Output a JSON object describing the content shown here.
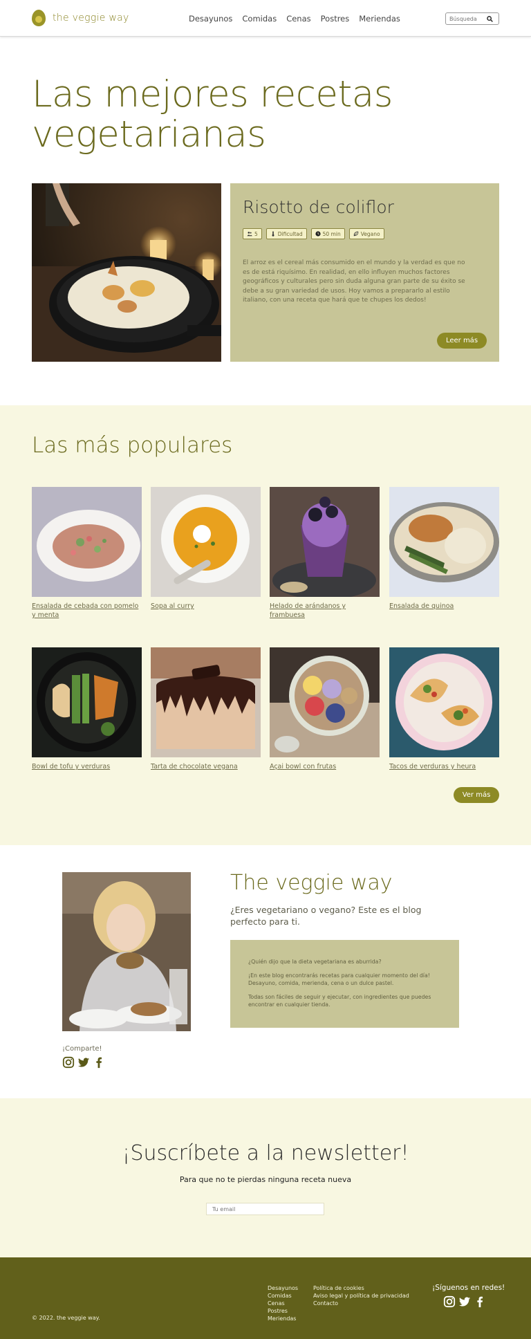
{
  "nav": {
    "brand": "the veggie way",
    "items": [
      "Desayunos",
      "Comidas",
      "Cenas",
      "Postres",
      "Meriendas"
    ],
    "search_placeholder": "Búsqueda"
  },
  "hero": {
    "title_line1": "Las mejores recetas",
    "title_line2": "vegetarianas"
  },
  "feature": {
    "title": "Risotto de coliflor",
    "badges": [
      {
        "icon": "people-icon",
        "label": "5"
      },
      {
        "icon": "thermometer-icon",
        "label": "Dificultad"
      },
      {
        "icon": "clock-icon",
        "label": "50 min"
      },
      {
        "icon": "vegan-icon",
        "label": "Vegano"
      }
    ],
    "description": "El arroz es el cereal más consumido en el mundo y la verdad es que no es de está riquísimo. En realidad, en ello influyen muchos factores geográficos y culturales pero sin duda alguna gran parte de su éxito se debe a su gran variedad de usos. Hoy vamos a prepararlo al estilo italiano, con una receta que hará que te chupes los dedos!",
    "button": "Leer más"
  },
  "popular": {
    "title": "Las más populares",
    "recipes": [
      "Ensalada de cebada con pomelo y menta",
      "Sopa al curry",
      "Helado de arándanos y frambuesa",
      "Ensalada de quinoa",
      "Bowl de tofu y verduras",
      "Tarta de chocolate vegana",
      "Açai bowl con frutas",
      "Tacos de verduras y heura"
    ],
    "button": "Ver más"
  },
  "about": {
    "title": "The veggie way",
    "subtitle": "¿Eres vegetariano o vegano? Este es el blog perfecto para ti.",
    "paragraphs": [
      "¿Quién dijo que la dieta vegetariana es aburrida?",
      "¡En este blog encontrarás recetas para cualquier momento del día! Desayuno, comida, merienda, cena o un dulce pastel.",
      "Todas son fáciles de seguir y ejecutar, con ingredientes que puedes encontrar en cualquier tienda."
    ],
    "share_label": "¡Comparte!"
  },
  "newsletter": {
    "title": "¡Suscríbete a la newsletter!",
    "subtitle": "Para que no te pierdas ninguna receta nueva",
    "placeholder": "Tu email"
  },
  "footer": {
    "copyright": "© 2022. the veggie way.",
    "links_col1": [
      "Desayunos",
      "Comidas",
      "Cenas",
      "Postres",
      "Meriendas"
    ],
    "links_col2": [
      "Política de cookies",
      "Aviso legal y política de privacidad",
      "Contacto"
    ],
    "follow": "¡Síguenos en redes!"
  },
  "colors": {
    "olive": "#6b6a1e",
    "accent": "#8d8a25",
    "card": "#c7c597",
    "cream": "#f8f7e1",
    "footer": "#61601b"
  }
}
